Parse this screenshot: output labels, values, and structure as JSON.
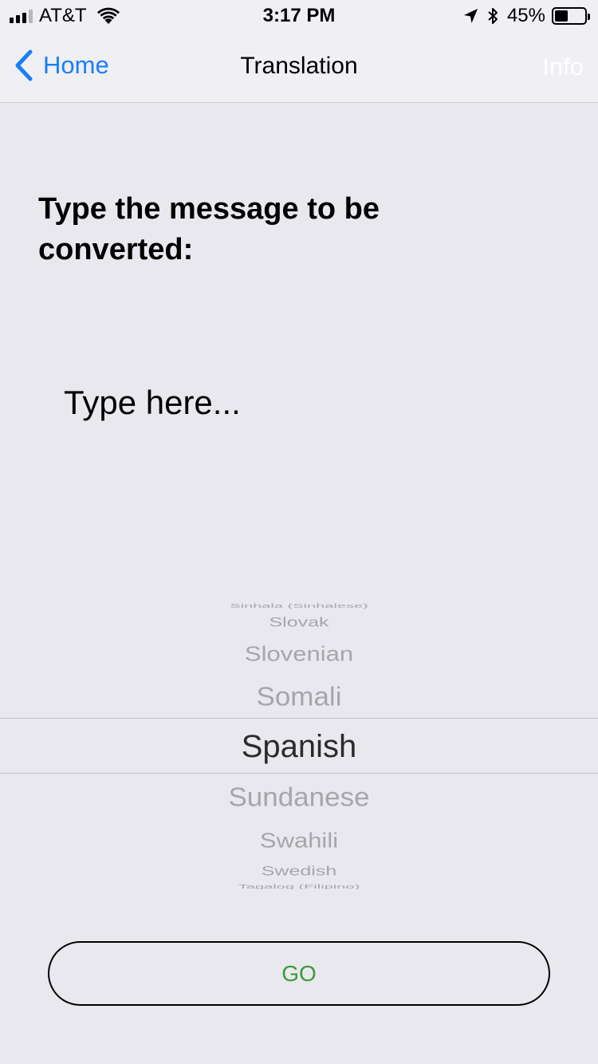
{
  "status_bar": {
    "carrier": "AT&T",
    "time": "3:17 PM",
    "battery_percent": "45%",
    "battery_level": 0.45
  },
  "nav": {
    "back_label": "Home",
    "title": "Translation",
    "info_label": "Info"
  },
  "content": {
    "prompt": "Type the message to be converted:",
    "input_placeholder": "Type here...",
    "input_value": ""
  },
  "picker": {
    "options": [
      "Sinhala (Sinhalese)",
      "Slovak",
      "Slovenian",
      "Somali",
      "Spanish",
      "Sundanese",
      "Swahili",
      "Swedish",
      "Tagalog (Filipino)"
    ],
    "selected": "Spanish"
  },
  "go_button": {
    "label": "GO"
  },
  "colors": {
    "accent_blue": "#1a7ff5",
    "go_green": "#3a9a3a",
    "background": "#e9e8ee",
    "bar_background": "#efeff4"
  }
}
